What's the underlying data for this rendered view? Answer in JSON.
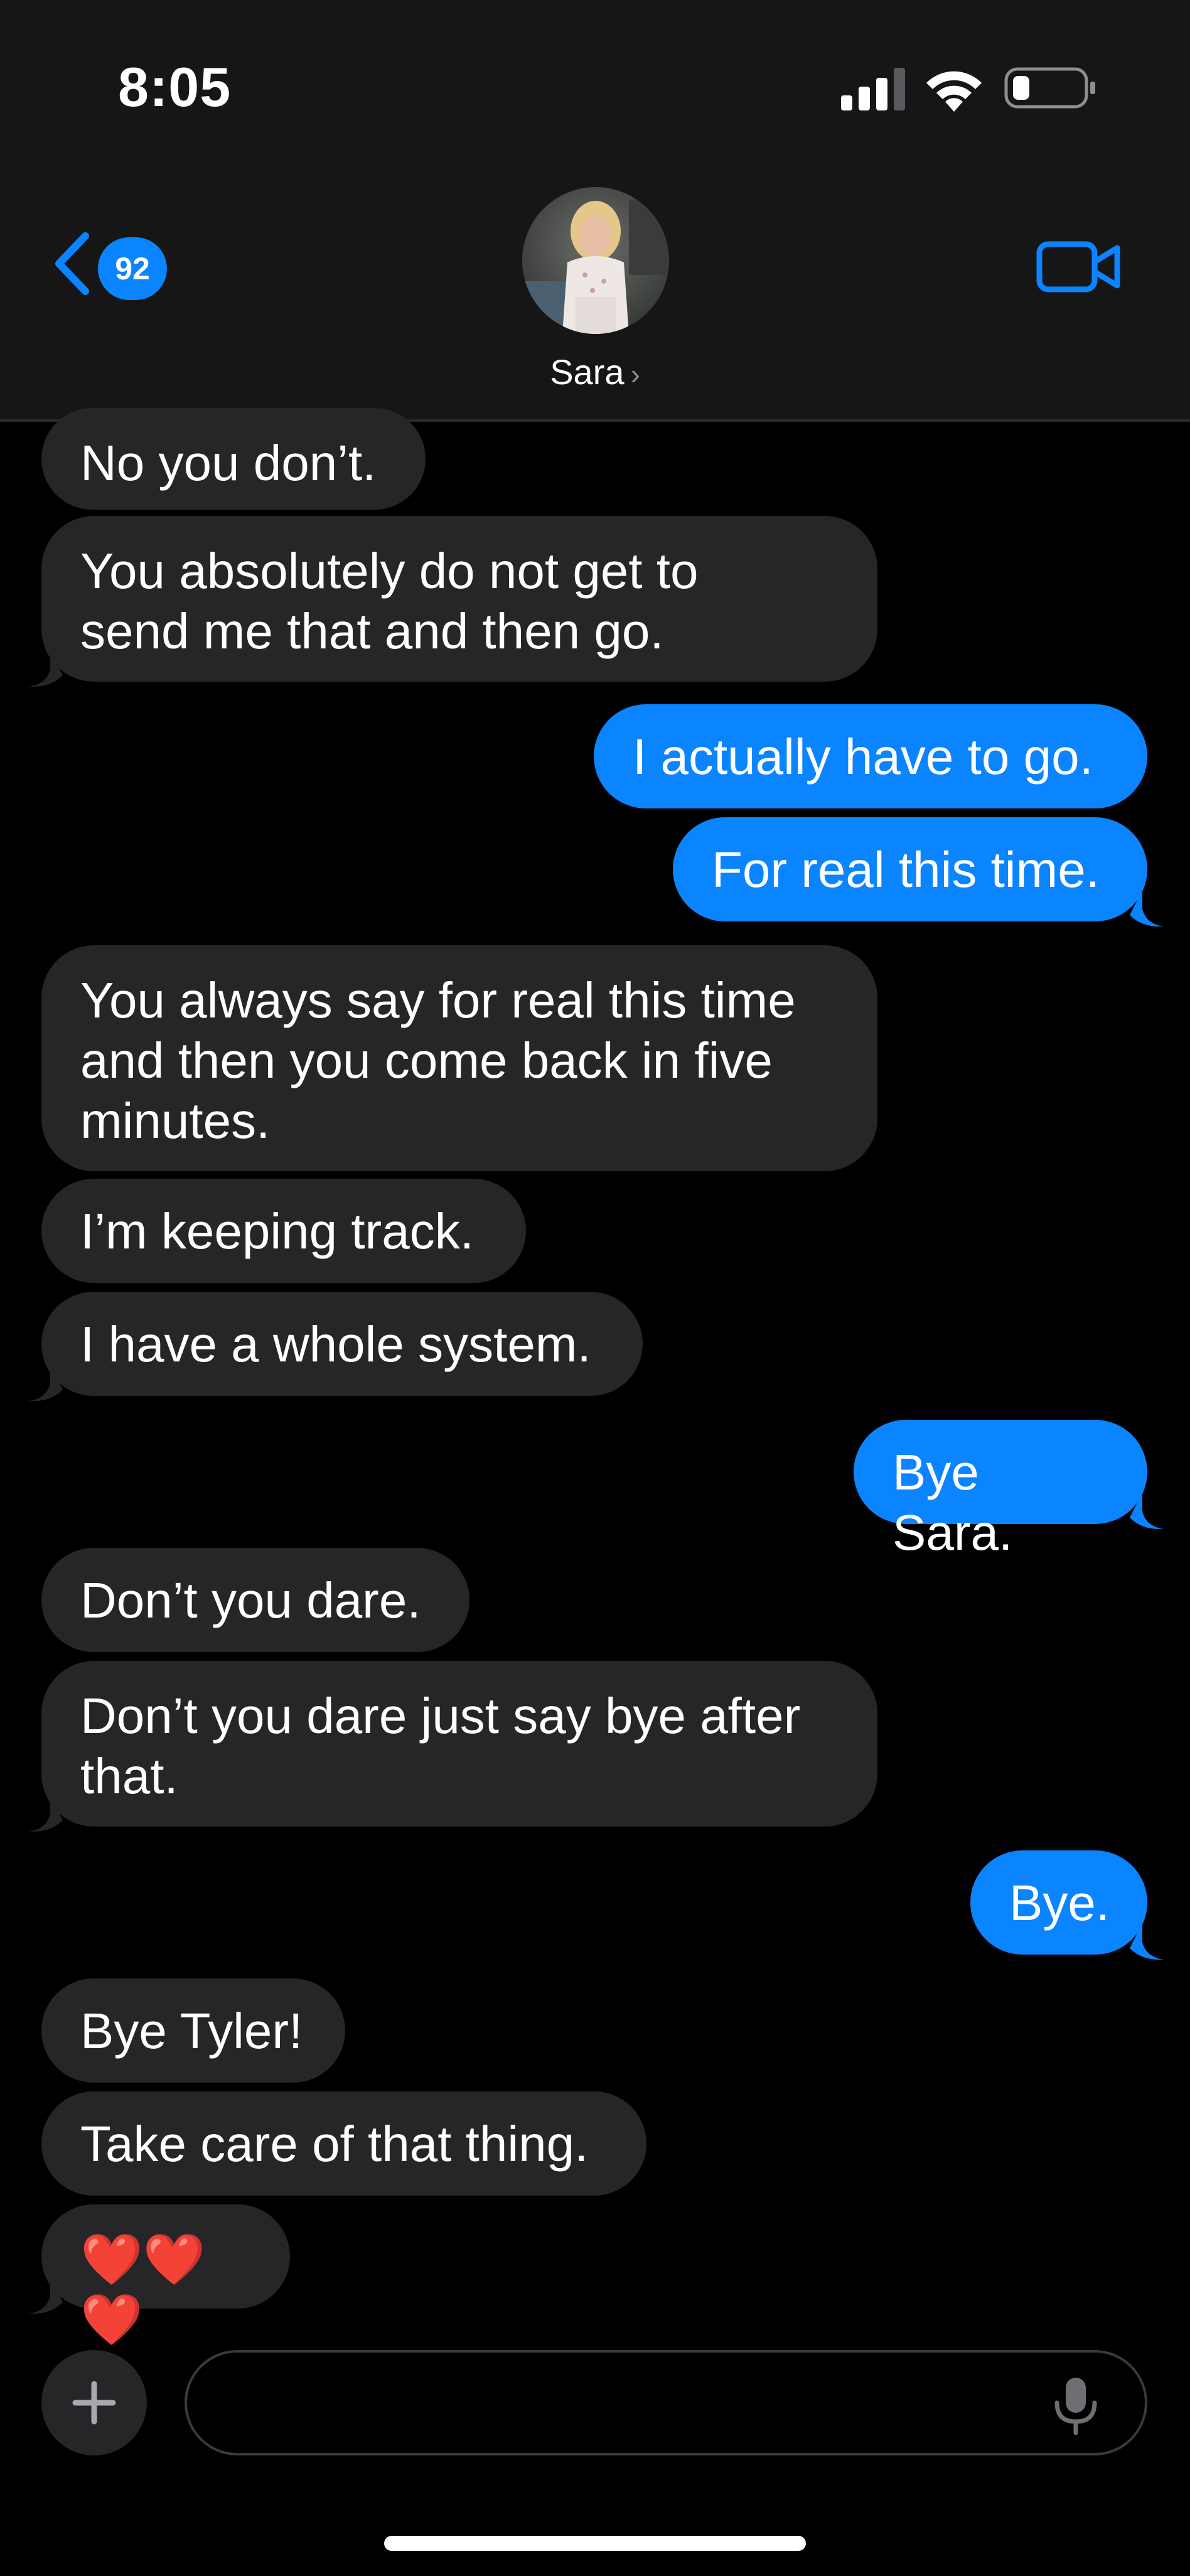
{
  "status_bar": {
    "time": "8:05",
    "icons": [
      "cellular-signal-icon",
      "wifi-icon",
      "battery-icon"
    ]
  },
  "header": {
    "back_badge_count": "92",
    "contact_name": "Sara",
    "name_chevron": "›",
    "icons": [
      "back-chevron-icon",
      "video-camera-icon"
    ]
  },
  "messages": [
    {
      "direction": "in",
      "text": "No you don’t."
    },
    {
      "direction": "in",
      "text": "You absolutely do not get to\nsend me that and then go."
    },
    {
      "direction": "out",
      "text": "I actually have to go."
    },
    {
      "direction": "out",
      "text": "For real this time."
    },
    {
      "direction": "in",
      "text": "You always say for real this time\nand then you come back in five\nminutes."
    },
    {
      "direction": "in",
      "text": "I’m keeping track."
    },
    {
      "direction": "in",
      "text": "I have a whole system."
    },
    {
      "direction": "out",
      "text": "Bye Sara."
    },
    {
      "direction": "in",
      "text": "Don’t you dare."
    },
    {
      "direction": "in",
      "text": "Don’t you dare just say bye after\nthat."
    },
    {
      "direction": "out",
      "text": "Bye."
    },
    {
      "direction": "in",
      "text": "Bye Tyler!"
    },
    {
      "direction": "in",
      "text": "Take care of that thing."
    },
    {
      "direction": "in",
      "text": "❤️❤️❤️"
    }
  ],
  "composer": {
    "placeholder": "",
    "icons": [
      "plus-icon",
      "microphone-icon"
    ]
  },
  "colors": {
    "incoming_bubble": "#262628",
    "outgoing_bubble": "#0a84ff",
    "accent": "#0a84ff",
    "background": "#000000",
    "header_background": "#161616"
  }
}
